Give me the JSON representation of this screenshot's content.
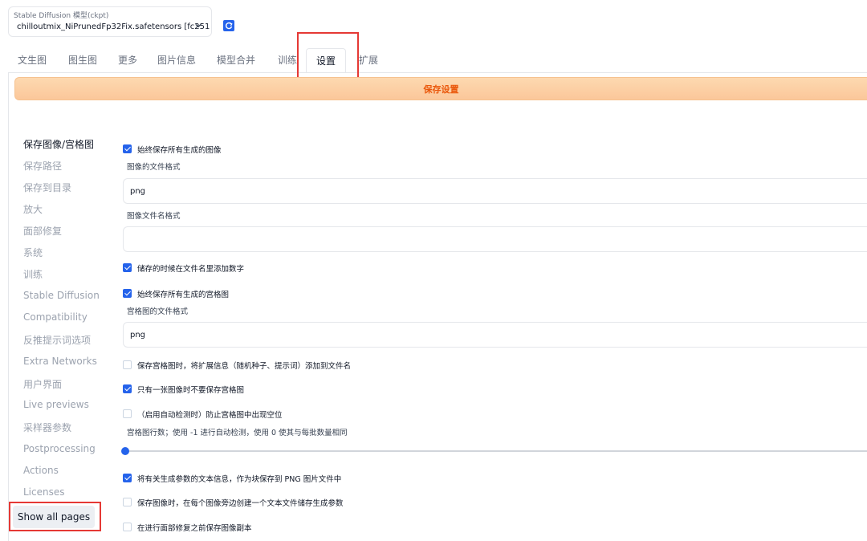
{
  "checkpoint": {
    "label": "Stable Diffusion 模型(ckpt)",
    "value": "chilloutmix_NiPrunedFp32Fix.safetensors [fc251",
    "chevron_icon": "chevron-down-icon",
    "refresh_icon": "refresh-icon"
  },
  "tabs": [
    {
      "label": "文生图"
    },
    {
      "label": "图生图"
    },
    {
      "label": "更多"
    },
    {
      "label": "图片信息"
    },
    {
      "label": "模型合并"
    },
    {
      "label": "训练"
    },
    {
      "label": "设置",
      "active": true
    },
    {
      "label": "扩展"
    }
  ],
  "save_button": "保存设置",
  "sidebar": {
    "items": [
      {
        "label": "保存图像/宫格图",
        "active": true
      },
      {
        "label": "保存路径"
      },
      {
        "label": "保存到目录"
      },
      {
        "label": "放大"
      },
      {
        "label": "面部修复"
      },
      {
        "label": "系统"
      },
      {
        "label": "训练"
      },
      {
        "label": "Stable Diffusion"
      },
      {
        "label": "Compatibility"
      },
      {
        "label": "反推提示词选项"
      },
      {
        "label": "Extra Networks"
      },
      {
        "label": "用户界面"
      },
      {
        "label": "Live previews"
      },
      {
        "label": "采样器参数"
      },
      {
        "label": "Postprocessing"
      },
      {
        "label": "Actions"
      },
      {
        "label": "Licenses"
      }
    ],
    "show_all": "Show all pages"
  },
  "settings": {
    "always_save_images": {
      "label": "始终保存所有生成的图像",
      "checked": true
    },
    "image_format": {
      "label": "图像的文件格式",
      "value": "png"
    },
    "filename_pattern": {
      "label": "图像文件名格式",
      "value": ""
    },
    "add_number": {
      "label": "储存的时候在文件名里添加数字",
      "checked": true
    },
    "always_save_grids": {
      "label": "始终保存所有生成的宫格图",
      "checked": true
    },
    "grid_format": {
      "label": "宫格图的文件格式",
      "value": "png"
    },
    "grid_extended_filename": {
      "label": "保存宫格图时，将扩展信息（随机种子、提示词）添加到文件名",
      "checked": false
    },
    "grid_only_if_multiple": {
      "label": "只有一张图像时不要保存宫格图",
      "checked": true
    },
    "grid_prevent_empty": {
      "label": "（启用自动检测时）防止宫格图中出现空位",
      "checked": false
    },
    "grid_rows": {
      "label": "宫格图行数；使用 -1 进行自动检测，使用 0 使其与每批数量相同",
      "value": -1
    },
    "enable_pnginfo": {
      "label": "将有关生成参数的文本信息，作为块保存到 PNG 图片文件中",
      "checked": true
    },
    "save_txt": {
      "label": "保存图像时，在每个图像旁边创建一个文本文件储存生成参数",
      "checked": false
    },
    "save_before_face_restore": {
      "label": "在进行面部修复之前保存图像副本",
      "checked": false
    }
  },
  "colors": {
    "accent": "#2563eb",
    "save_button_text": "#ea580c",
    "highlight": "#e53935"
  }
}
